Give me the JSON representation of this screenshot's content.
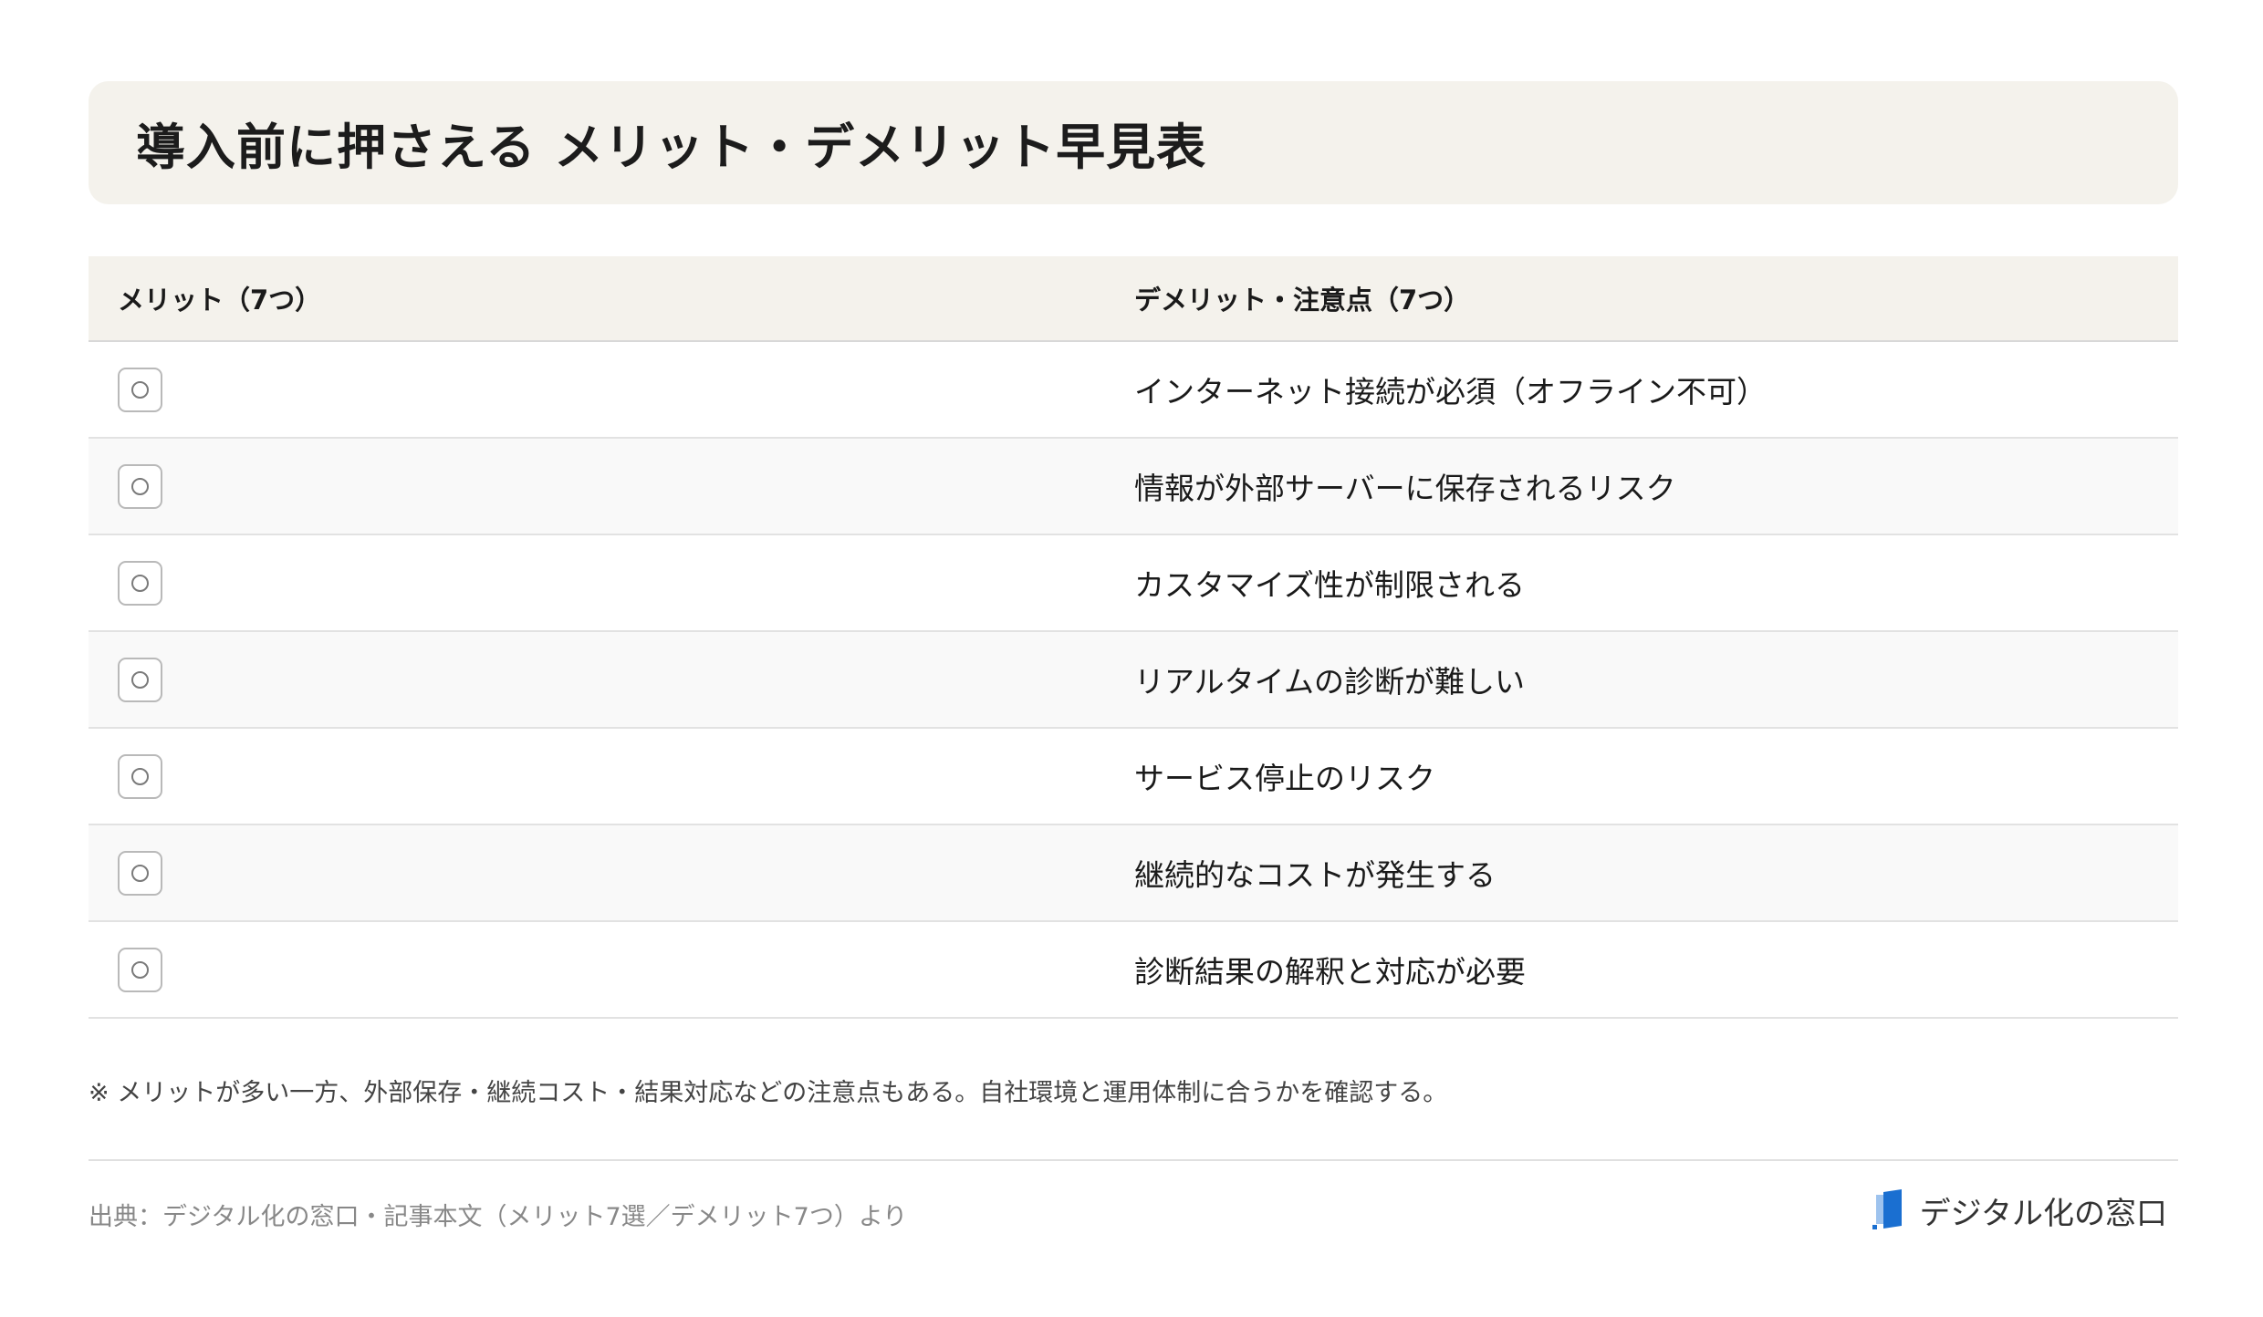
{
  "title": "導入前に押さえる メリット・デメリット早見表",
  "table": {
    "headers": [
      "メリット（7つ）",
      "デメリット・注意点（7つ）"
    ],
    "rows": [
      {
        "merit": "",
        "demerit": "インターネット接続が必須（オフライン不可）"
      },
      {
        "merit": "",
        "demerit": "情報が外部サーバーに保存されるリスク"
      },
      {
        "merit": "",
        "demerit": "カスタマイズ性が制限される"
      },
      {
        "merit": "",
        "demerit": "リアルタイムの診断が難しい"
      },
      {
        "merit": "",
        "demerit": "サービス停止のリスク"
      },
      {
        "merit": "",
        "demerit": "継続的なコストが発生する"
      },
      {
        "merit": "",
        "demerit": "診断結果の解釈と対応が必要"
      }
    ]
  },
  "note": "※ メリットが多い一方、外部保存・継続コスト・結果対応などの注意点もある。自社環境と運用体制に合うかを確認する。",
  "source": "出典：デジタル化の窓口・記事本文（メリット7選／デメリット7つ）より",
  "brand": {
    "name": "デジタル化の窓口",
    "logo_icon": "book-logo-icon",
    "accent_color": "#1a6fd1"
  },
  "colors": {
    "banner_bg": "#f4f2ec",
    "header_bg": "#f4f2ec",
    "alt_row_bg": "#f9f9f9"
  }
}
